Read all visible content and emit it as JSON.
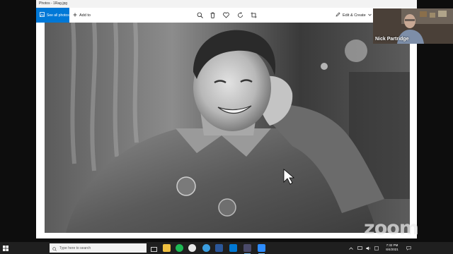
{
  "titlebar": {
    "text": "Photos - 1Rag.jpg"
  },
  "toolbar": {
    "see_all_label": "See all photos",
    "add_to_label": "Add to",
    "edit_create_label": "Edit & Create",
    "icons": [
      "zoom-icon",
      "delete-icon",
      "favorite-icon",
      "rotate-icon",
      "crop-icon"
    ]
  },
  "video": {
    "participant_name": "Nick Partridge"
  },
  "watermark": {
    "text": "zoom"
  },
  "taskbar": {
    "search_placeholder": "Type here to search",
    "time": "7:32 PM",
    "date": "8/4/2021"
  },
  "colors": {
    "accent": "#0078d7",
    "taskbar": "#1f1f1f",
    "background": "#0d0d0d"
  }
}
